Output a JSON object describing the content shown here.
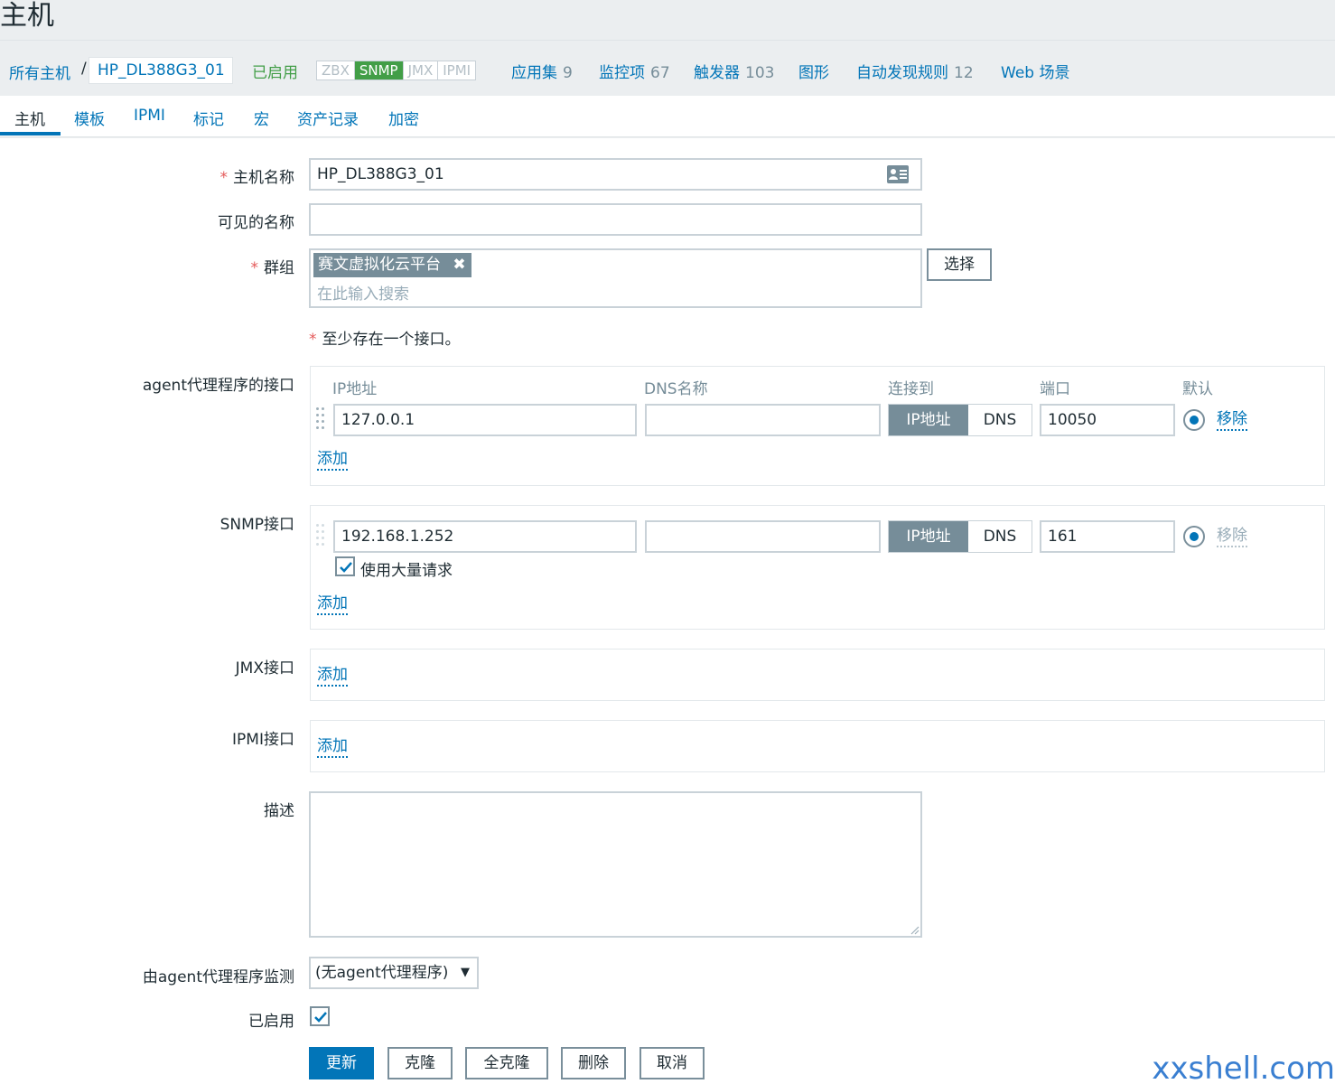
{
  "page": {
    "title": "主机"
  },
  "nav": {
    "all_hosts": "所有主机",
    "separator": "/",
    "current_host": "HP_DL388G3_01",
    "status": "已启用",
    "availability": [
      "ZBX",
      "SNMP",
      "JMX",
      "IPMI"
    ],
    "active_availability": "SNMP",
    "links": [
      {
        "label": "应用集",
        "count": "9"
      },
      {
        "label": "监控项",
        "count": "67"
      },
      {
        "label": "触发器",
        "count": "103"
      },
      {
        "label": "图形",
        "count": ""
      },
      {
        "label": "自动发现规则",
        "count": "12"
      },
      {
        "label": "Web 场景",
        "count": ""
      }
    ]
  },
  "tabs": [
    "主机",
    "模板",
    "IPMI",
    "标记",
    "宏",
    "资产记录",
    "加密"
  ],
  "active_tab": "主机",
  "form": {
    "host_name_label": "主机名称",
    "host_name_value": "HP_DL388G3_01",
    "visible_name_label": "可见的名称",
    "visible_name_value": "",
    "groups_label": "群组",
    "group_tag": "赛文虚拟化云平台",
    "group_search_placeholder": "在此输入搜索",
    "select_button": "选择",
    "interface_note": "至少存在一个接口。",
    "agent_label": "agent代理程序的接口",
    "columns": {
      "ip": "IP地址",
      "dns": "DNS名称",
      "connect": "连接到",
      "port": "端口",
      "default": "默认"
    },
    "agent_iface": {
      "ip": "127.0.0.1",
      "dns": "",
      "conn_ip": "IP地址",
      "conn_dns": "DNS",
      "port": "10050",
      "remove": "移除"
    },
    "snmp_label": "SNMP接口",
    "snmp_iface": {
      "ip": "192.168.1.252",
      "dns": "",
      "conn_ip": "IP地址",
      "conn_dns": "DNS",
      "port": "161",
      "remove": "移除",
      "bulk_label": "使用大量请求",
      "bulk_checked": true
    },
    "jmx_label": "JMX接口",
    "ipmi_label": "IPMI接口",
    "add_link": "添加",
    "description_label": "描述",
    "description_value": "",
    "monitored_by_label": "由agent代理程序监测",
    "proxy_value": "(无agent代理程序)",
    "enabled_label": "已启用",
    "enabled_checked": true
  },
  "buttons": {
    "update": "更新",
    "clone": "克隆",
    "full_clone": "全克隆",
    "delete": "删除",
    "cancel": "取消"
  },
  "watermark": "xxshell.com",
  "colors": {
    "accent": "#0275b8",
    "green": "#429e47",
    "required": "#e45959"
  }
}
